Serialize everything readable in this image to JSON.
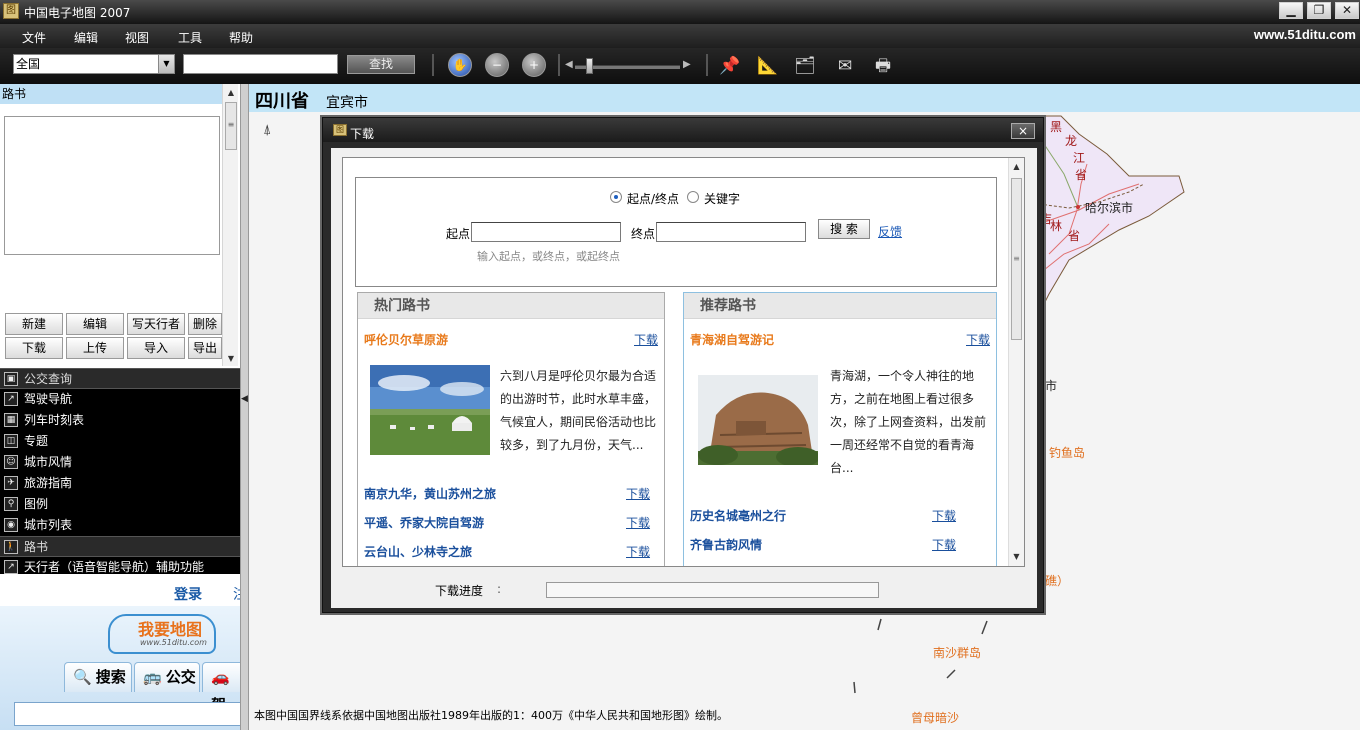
{
  "window": {
    "title": "中国电子地图 2007",
    "app_icon": "map-app-icon",
    "buttons": [
      "minimize",
      "maximize",
      "close"
    ]
  },
  "menu": {
    "items": [
      "文件",
      "编辑",
      "视图",
      "工具",
      "帮助"
    ],
    "site_url": "www.51ditu.com"
  },
  "toolbar": {
    "region_value": "全国",
    "search_value": "",
    "find_label": "查找",
    "icons": [
      "pan-hand-icon",
      "zoom-out-icon",
      "zoom-in-icon",
      "pin-icon",
      "ruler-icon",
      "folder-icon",
      "mail-icon",
      "print-icon"
    ]
  },
  "left_panel": {
    "roadbook_header": "路书",
    "buttons_row1": [
      "新建",
      "编辑",
      "写天行者",
      "删除"
    ],
    "buttons_row2": [
      "下载",
      "上传",
      "导入",
      "导出"
    ],
    "nav": [
      {
        "label": "公交查询",
        "icon": "bus-icon",
        "selected": true
      },
      {
        "label": "驾驶导航",
        "icon": "arrow-icon",
        "selected": false
      },
      {
        "label": "列车时刻表",
        "icon": "train-icon",
        "selected": false
      },
      {
        "label": "专题",
        "icon": "topic-icon",
        "selected": false
      },
      {
        "label": "城市风情",
        "icon": "person-icon",
        "selected": false
      },
      {
        "label": "旅游指南",
        "icon": "tour-icon",
        "selected": false
      },
      {
        "label": "图例",
        "icon": "legend-icon",
        "selected": false
      },
      {
        "label": "城市列表",
        "icon": "globe-icon",
        "selected": false
      },
      {
        "label": "路书",
        "icon": "walker-icon",
        "selected": true
      },
      {
        "label": "天行者（语音智能导航）辅助功能",
        "icon": "navigator-icon",
        "selected": false
      }
    ],
    "web": {
      "login": "登录",
      "login2": "注",
      "logo_text": "我要地图",
      "logo_sub": "www.51ditu.com",
      "tabs": [
        {
          "label": "搜索",
          "icon": "search-icon"
        },
        {
          "label": "公交",
          "icon": "bus-icon"
        },
        {
          "label": "驾",
          "icon": "car-icon"
        }
      ]
    }
  },
  "map": {
    "province": "四川省",
    "city": "宜宾市",
    "footer": "本图中国国界线系依据中国地图出版社1989年出版的1：400万《中华人民共和国地形图》绘制。",
    "labels": {
      "hei": "黑",
      "long": "龙",
      "jiang": "江",
      "sheng1": "省",
      "harbin": "哈尔滨市",
      "ji": "吉",
      "lin": "林",
      "sheng2": "省",
      "shi": "市",
      "diaoyu": "钓鱼岛",
      "jiao": "礁）",
      "nansha": "南沙群岛",
      "zengmu": "曾母暗沙"
    },
    "colors": {
      "northeast_region": "#efe6f7",
      "road": "#e07070",
      "border": "#7a5a3a"
    }
  },
  "dialog": {
    "title": "下载",
    "close": "×",
    "search": {
      "radio_a": "起点/终点",
      "radio_b": "关键字",
      "start_label": "起点",
      "end_label": "终点",
      "start_value": "",
      "end_value": "",
      "search_button": "搜 索",
      "feedback": "反馈",
      "hint": "输入起点，或终点，或起终点"
    },
    "hot": {
      "header": "热门路书",
      "featured_title": "呼伦贝尔草原游",
      "featured_download": "下载",
      "description": [
        "六到八月是呼伦贝尔最为合适",
        "的出游时节，此时水草丰盛，",
        "气候宜人，期间民俗活动也比",
        "较多，到了九月份，天气..."
      ],
      "routes": [
        {
          "title": "南京九华，黄山苏州之旅",
          "download": "下载"
        },
        {
          "title": "平遥、乔家大院自驾游",
          "download": "下载"
        },
        {
          "title": "云台山、少林寺之旅",
          "download": "下载"
        }
      ]
    },
    "recommended": {
      "header": "推荐路书",
      "featured_title": "青海湖自驾游记",
      "featured_download": "下载",
      "description": [
        "青海湖，一个令人神往的地",
        "方，之前在地图上看过很多",
        "次，除了上网查资料，出发前",
        "一周还经常不自觉的看青海",
        "台..."
      ],
      "routes": [
        {
          "title": "历史名城亳州之行",
          "download": "下载"
        },
        {
          "title": "齐鲁古韵风情",
          "download": "下载"
        }
      ]
    },
    "progress_label": "下载进度",
    "progress_colon": ":",
    "progress_value": 0
  }
}
